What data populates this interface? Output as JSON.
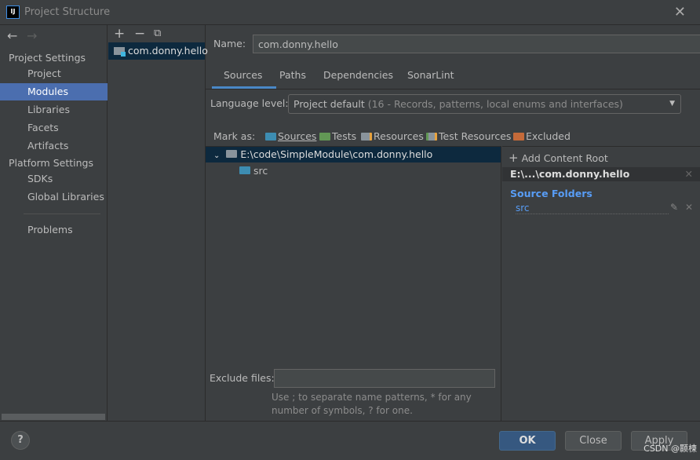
{
  "window": {
    "title": "Project Structure",
    "logo": "IJ"
  },
  "sidebar": {
    "project_settings": "Project Settings",
    "platform_settings": "Platform Settings",
    "items": [
      {
        "label": "Project"
      },
      {
        "label": "Modules"
      },
      {
        "label": "Libraries"
      },
      {
        "label": "Facets"
      },
      {
        "label": "Artifacts"
      },
      {
        "label": "SDKs"
      },
      {
        "label": "Global Libraries"
      },
      {
        "label": "Problems"
      }
    ]
  },
  "modules": {
    "items": [
      "com.donny.hello"
    ]
  },
  "main": {
    "name_label": "Name:",
    "name_value": "com.donny.hello",
    "tabs": [
      "Sources",
      "Paths",
      "Dependencies",
      "SonarLint"
    ],
    "language_label": "Language level:",
    "language_value": "Project default",
    "language_detail": "(16 - Records, patterns, local enums and interfaces)",
    "mark_as": "Mark as:",
    "marks": [
      "Sources",
      "Tests",
      "Resources",
      "Test Resources",
      "Excluded"
    ],
    "tree_root": "E:\\code\\SimpleModule\\com.donny.hello",
    "tree_child": "src",
    "add_root": "Add Content Root",
    "root_short": "E:\\...\\com.donny.hello",
    "source_folders": "Source Folders",
    "source_item": "src",
    "exclude_label": "Exclude files:",
    "exclude_value": "",
    "exclude_hint1": "Use ; to separate name patterns, * for any",
    "exclude_hint2": "number of symbols, ? for one."
  },
  "footer": {
    "help": "?",
    "ok": "OK",
    "close": "Close",
    "apply": "Apply"
  },
  "watermark": "CSDN @颢楝",
  "colors": {
    "selection": "#4b6eaf",
    "tree_selection": "#0d293e",
    "sources": "#3d8db2",
    "tests": "#629755",
    "excluded": "#c56a39",
    "link": "#589df6"
  }
}
